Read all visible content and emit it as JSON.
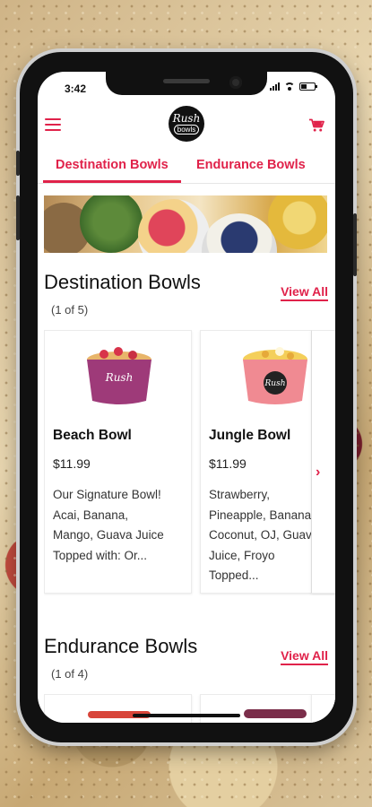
{
  "status_bar": {
    "time": "3:42"
  },
  "header": {
    "logo_line1": "Rush",
    "logo_line2": "bowls"
  },
  "tabs": [
    {
      "label": "Destination Bowls",
      "active": true
    },
    {
      "label": "Endurance Bowls",
      "active": false
    }
  ],
  "sections": [
    {
      "title": "Destination Bowls",
      "count": "(1 of 5)",
      "view_all": "View All",
      "cards": [
        {
          "name": "Beach Bowl",
          "price": "$11.99",
          "description": "Our Signature Bowl!\nAcai, Banana,\nMango, Guava Juice\nTopped with: Or...",
          "cup_color": "#9e3a79"
        },
        {
          "name": "Jungle Bowl",
          "price": "$11.99",
          "description": "Strawberry,\nPineapple, Banana,\nCoconut, OJ, Guava\nJuice, Froyo\nTopped...",
          "cup_color": "#f08a92"
        }
      ]
    },
    {
      "title": "Endurance Bowls",
      "count": "(1 of 4)",
      "view_all": "View All"
    }
  ],
  "colors": {
    "accent": "#e0224a"
  },
  "icons": [
    "hamburger-menu-icon",
    "cart-icon",
    "chevron-right-icon"
  ]
}
